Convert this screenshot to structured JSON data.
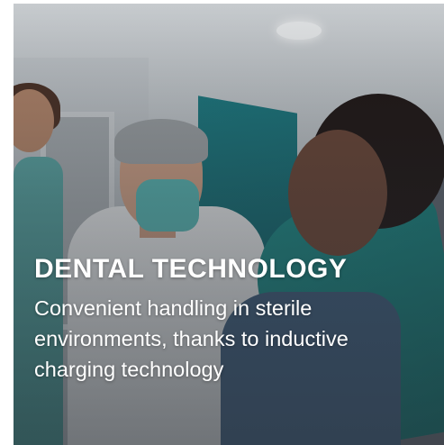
{
  "card": {
    "heading": "DENTAL TECHNOLOGY",
    "description": "Convenient handling in sterile environments, thanks to inductive charging technology",
    "image_subject": "dentist-with-patient-photo"
  },
  "colors": {
    "text": "#ffffff",
    "accent_teal": "#1a7b82",
    "overlay": "#282c32"
  }
}
